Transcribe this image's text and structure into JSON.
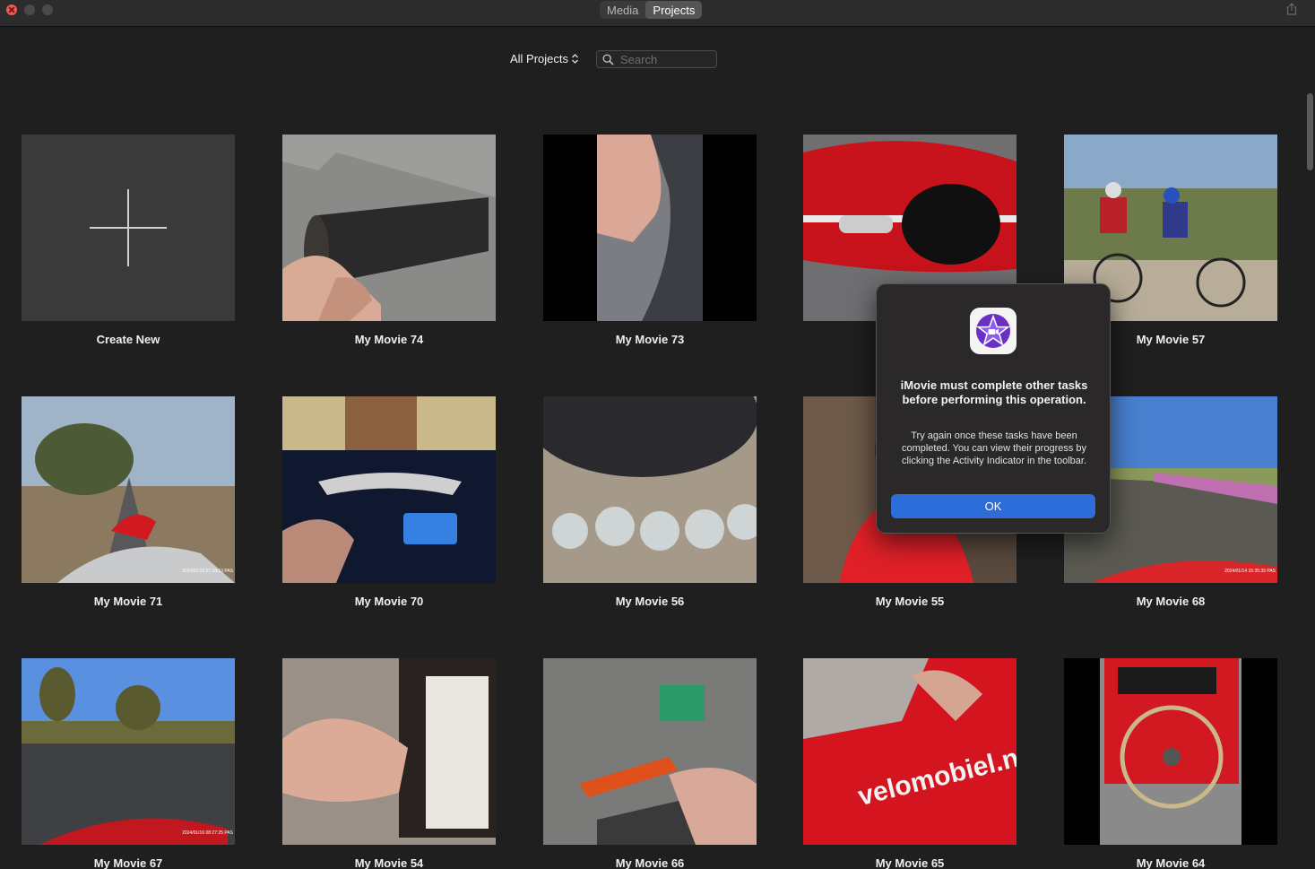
{
  "titlebar": {
    "tabs": [
      {
        "label": "Media",
        "active": false
      },
      {
        "label": "Projects",
        "active": true
      }
    ]
  },
  "toolbar": {
    "filter_label": "All Projects",
    "search_placeholder": "Search"
  },
  "projects": [
    {
      "label": "Create New"
    },
    {
      "label": "My Movie 74"
    },
    {
      "label": "My Movie 73"
    },
    {
      "label": ""
    },
    {
      "label": "My Movie 57"
    },
    {
      "label": "My Movie 71"
    },
    {
      "label": "My Movie 70"
    },
    {
      "label": "My Movie 56"
    },
    {
      "label": "My Movie 55"
    },
    {
      "label": "My Movie 68"
    },
    {
      "label": "My Movie 67"
    },
    {
      "label": "My Movie 54"
    },
    {
      "label": "My Movie 66"
    },
    {
      "label": "My Movie 65"
    },
    {
      "label": "My Movie 64"
    }
  ],
  "thumb_text": {
    "movie71_stamp": "2024/01/23 07:18:13 PAS",
    "movie68_stamp": "2024/01/14 15:35:35 PAS",
    "movie67_stamp": "2024/01/16 08:27:25 PAS",
    "movie65_brand": "velomobiel.nl"
  },
  "dialog": {
    "title": "iMovie must complete other tasks before performing this operation.",
    "body": "Try again once these tasks have been completed. You can view their progress by clicking the Activity Indicator in the toolbar.",
    "ok_label": "OK"
  },
  "colors": {
    "accent": "#2c6dd9",
    "background": "#1f1f1f",
    "close_button": "#ee5a55"
  }
}
